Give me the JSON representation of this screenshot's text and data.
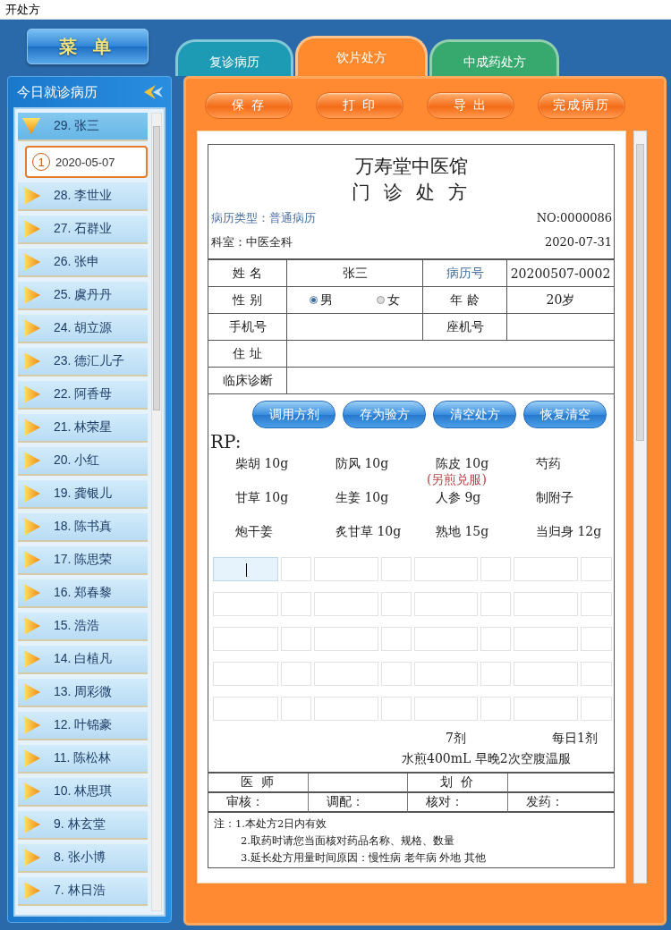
{
  "window": {
    "title": "开处方"
  },
  "menu_button": "菜 单",
  "sidebar": {
    "title": "今日就诊病历",
    "items": [
      {
        "label": "29. 张三",
        "expanded": true,
        "children": [
          {
            "index": "1",
            "date": "2020-05-07",
            "selected": true
          }
        ]
      },
      {
        "label": "28. 李世业",
        "expanded": false
      },
      {
        "label": "27. 石群业",
        "expanded": false
      },
      {
        "label": "26. 张申",
        "expanded": false
      },
      {
        "label": "25. 虞丹丹",
        "expanded": false
      },
      {
        "label": "24. 胡立源",
        "expanded": false
      },
      {
        "label": "23. 德汇儿子",
        "expanded": false
      },
      {
        "label": "22. 阿香母",
        "expanded": false
      },
      {
        "label": "21. 林荣星",
        "expanded": false
      },
      {
        "label": "20. 小红",
        "expanded": false
      },
      {
        "label": "19. 龚银儿",
        "expanded": false
      },
      {
        "label": "18. 陈书真",
        "expanded": false
      },
      {
        "label": "17. 陈思荣",
        "expanded": false
      },
      {
        "label": "16. 郑春黎",
        "expanded": false
      },
      {
        "label": "15. 浩浩",
        "expanded": false
      },
      {
        "label": "14. 白植凡",
        "expanded": false
      },
      {
        "label": "13. 周彩微",
        "expanded": false
      },
      {
        "label": "12. 叶锦豪",
        "expanded": false
      },
      {
        "label": "11. 陈松林",
        "expanded": false
      },
      {
        "label": "10. 林思琪",
        "expanded": false
      },
      {
        "label": "9. 林玄堂",
        "expanded": false
      },
      {
        "label": "8. 张小博",
        "expanded": false
      },
      {
        "label": "7. 林日浩",
        "expanded": false
      }
    ]
  },
  "tabs": [
    {
      "label": "复诊病历",
      "selected": false,
      "color": "#1d9bb5"
    },
    {
      "label": "饮片处方",
      "selected": true,
      "color": "#ff8a2e"
    },
    {
      "label": "中成药处方",
      "selected": false,
      "color": "#37a86e"
    }
  ],
  "toolbar": [
    "保 存",
    "打 印",
    "导 出",
    "完成病历"
  ],
  "prescription": {
    "clinic": "万寿堂中医馆",
    "title": "门 诊 处 方",
    "record_type": "病历类型：普通病历",
    "number": "NO:0000086",
    "department": "科室：中医全科",
    "date": "2020-07-31",
    "name_label": "姓 名",
    "name": "张三",
    "record_no_label": "病历号",
    "record_no": "20200507-0002",
    "sex_label": "性 别",
    "sex_options": [
      {
        "label": "男",
        "selected": true
      },
      {
        "label": "女",
        "selected": false
      }
    ],
    "age_label": "年 龄",
    "age": "20岁",
    "mobile_label": "手机号",
    "landline_label": "座机号",
    "address_label": "住 址",
    "diagnosis_label": "临床诊断",
    "actions": [
      "调用方剂",
      "存为验方",
      "清空处方",
      "恢复清空"
    ],
    "rp_label": "RP:",
    "herbs": [
      {
        "text": "柴胡 10g"
      },
      {
        "text": "防风 10g"
      },
      {
        "text": "陈皮 10g"
      },
      {
        "text": "芍药"
      },
      {
        "text": "甘草 10g"
      },
      {
        "text": "生姜 10g"
      },
      {
        "text": "人参 9g",
        "note": "(另煎兑服)"
      },
      {
        "text": "制附子"
      },
      {
        "text": "炮干姜"
      },
      {
        "text": "炙甘草 10g"
      },
      {
        "text": "熟地 15g"
      },
      {
        "text": "当归身 12g"
      }
    ],
    "entry_grid": {
      "first_cell_focused": true
    },
    "doses": "7剂",
    "frequency": "每日1剂",
    "usage": "水煎400mL 早晚2次空腹温服",
    "doctor_label": "医 师",
    "pricing_label": "划 价",
    "signatures": [
      "审核：",
      "调配：",
      "核对：",
      "发药："
    ],
    "notes": [
      "注：1.本处方2日内有效",
      "2.取药时请您当面核对药品名称、规格、数量",
      "3.延长处方用量时间原因：慢性病 老年病 外地 其他"
    ]
  }
}
